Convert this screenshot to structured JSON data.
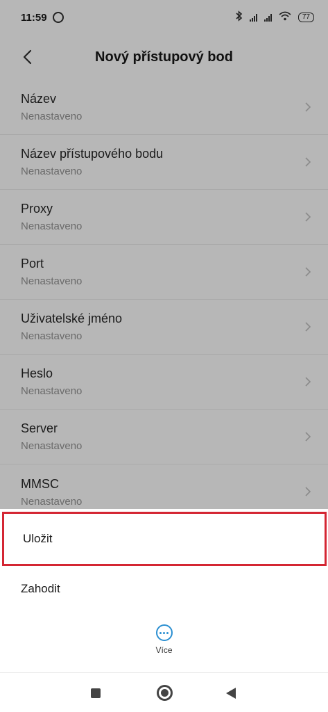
{
  "status": {
    "time": "11:59",
    "battery": "77"
  },
  "appbar": {
    "title": "Nový přístupový bod"
  },
  "items": [
    {
      "label": "Název",
      "value": "Nenastaveno"
    },
    {
      "label": "Název přístupového bodu",
      "value": "Nenastaveno"
    },
    {
      "label": "Proxy",
      "value": "Nenastaveno"
    },
    {
      "label": "Port",
      "value": "Nenastaveno"
    },
    {
      "label": "Uživatelské jméno",
      "value": "Nenastaveno"
    },
    {
      "label": "Heslo",
      "value": "Nenastaveno"
    },
    {
      "label": "Server",
      "value": "Nenastaveno"
    },
    {
      "label": "MMSC",
      "value": "Nenastaveno"
    }
  ],
  "menu": {
    "save": "Uložit",
    "discard": "Zahodit",
    "more": "Více"
  },
  "colors": {
    "highlight": "#d42633",
    "accent": "#2b8fd1"
  }
}
